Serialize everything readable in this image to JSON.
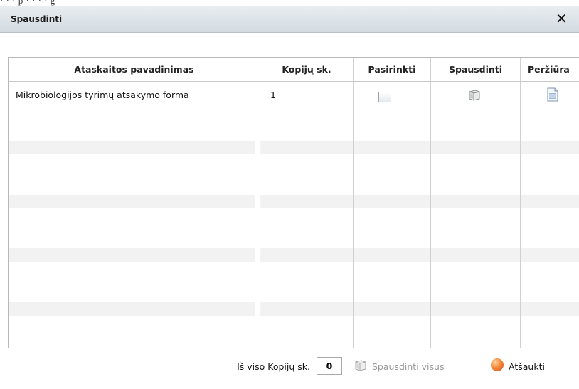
{
  "background_strip": {
    "text": "· ·   ·   p   ·  ·     ·   ·  g"
  },
  "dialog": {
    "title": "Spausdinti",
    "close_glyph": "✕"
  },
  "table": {
    "columns": [
      "Ataskaitos pavadinimas",
      "Kopijų sk.",
      "Pasirinkti",
      "Spausdinti",
      "Peržiūra"
    ],
    "rows": [
      {
        "name": "Mikrobiologijos tyrimų atsakymo forma",
        "copies": "1",
        "selected": false
      }
    ]
  },
  "footer": {
    "total_label": "Iš viso Kopijų sk.",
    "total_value": "0",
    "print_all_label": "Spausdinti visus",
    "cancel_label": "Atšaukti"
  },
  "icons": {
    "print": "printer-icon",
    "preview": "document-preview-icon",
    "cancel": "cancel-orb-icon",
    "close": "close-icon"
  }
}
